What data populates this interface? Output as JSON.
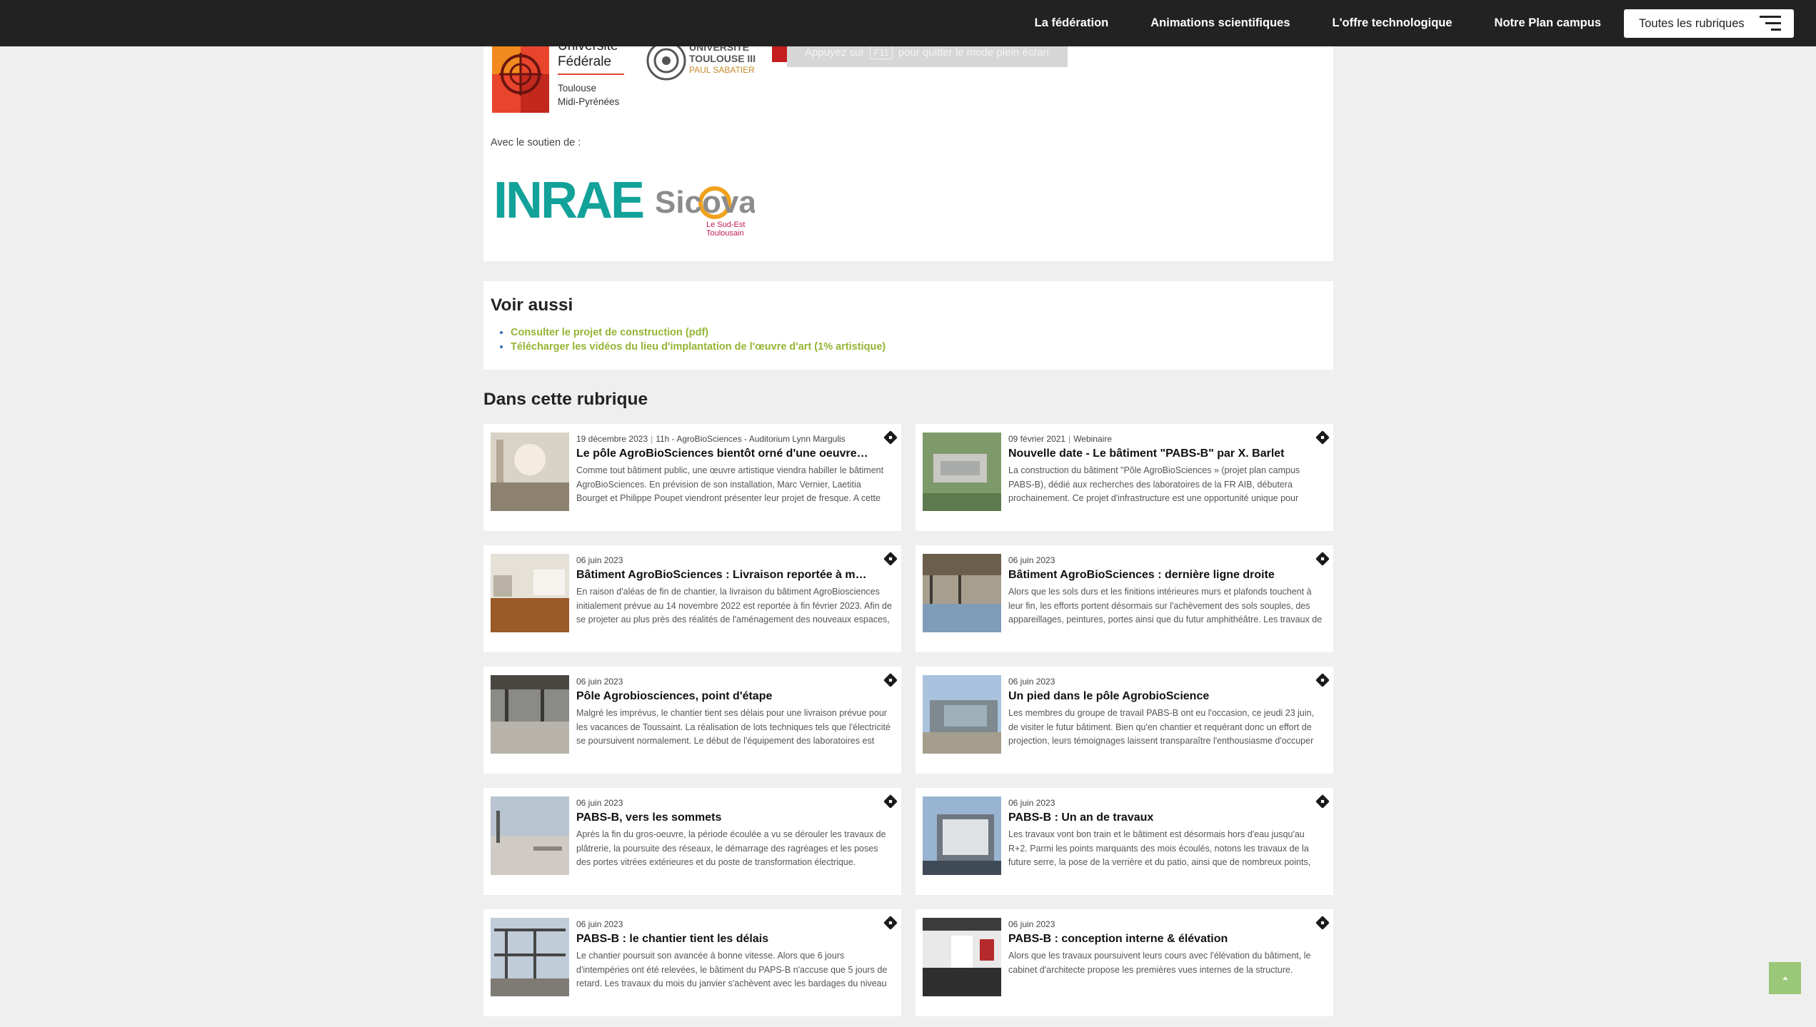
{
  "nav": {
    "items": [
      "La fédération",
      "Animations scientifiques",
      "L'offre technologique",
      "Notre Plan campus"
    ],
    "rubriques_label": "Toutes les rubriques"
  },
  "partners": {
    "ufmp_lines": [
      "Université",
      "Fédérale",
      "Toulouse",
      "Midi-Pyrénées"
    ],
    "ut3_lines": [
      "UNIVERSITÉ",
      "TOULOUSE III",
      "PAUL SABATIER"
    ],
    "esc_notice": {
      "before": "Appuyez sur",
      "key": "F11",
      "after": "pour quitter le mode plein écran"
    },
    "soutien_label": "Avec le soutien de :",
    "inrae": "INRAE",
    "sicoval": {
      "name": "Sicoval",
      "tagline1": "Le Sud-Est",
      "tagline2": "Toulousain"
    }
  },
  "voir_aussi": {
    "title": "Voir aussi",
    "links": [
      "Consulter le projet de construction (pdf)",
      "Télécharger les vidéos du lieu d'implantation de l'œuvre d'art (1% artistique)"
    ]
  },
  "rubrique": {
    "title": "Dans cette rubrique",
    "articles": [
      {
        "meta": [
          "19 décembre 2023",
          "11h - AgroBioSciences - Auditorium Lynn Margulis"
        ],
        "title": "Le pôle AgroBioSciences bientôt orné d'une oeuvre…",
        "text": "Comme tout bâtiment public, une œuvre artistique viendra habiller le bâtiment AgroBioSciences. En prévision de son installation, Marc Vernier, Laetitia Bourget et Philippe Poupet viendront présenter leur projet de fresque. A cette occasion, les…",
        "thumb": "atrium"
      },
      {
        "meta": [
          "09 février 2021",
          "Webinaire"
        ],
        "title": "Nouvelle date - Le bâtiment \"PABS-B\" par X. Barlet",
        "text": "La construction du bâtiment \"Pôle AgroBioSciences » (projet plan campus PABS-B), dédié aux recherches des laboratoires de la FR AIB, débutera prochainement. Ce projet d'infrastructure est une opportunité unique pour accroître les synergies entre équipes…",
        "thumb": "aerial"
      },
      {
        "meta": [
          "06 juin 2023"
        ],
        "title": "Bâtiment AgroBioSciences : Livraison reportée à mars…",
        "text": "En raison d'aléas de fin de chantier, la livraison du bâtiment AgroBiosciences initialement prévue au 14 novembre 2022 est reportée à fin février 2023. Afin de se projeter au plus près des réalités de l'aménagement des nouveaux espaces, le…",
        "thumb": "interior"
      },
      {
        "meta": [
          "06 juin 2023"
        ],
        "title": "Bâtiment AgroBioSciences : dernière ligne droite",
        "text": "Alors que les sols durs et les finitions intérieures murs et plafonds touchent à leur fin, les efforts portent désormais sur l'achèvement des sols souples, des appareillages, peintures, portes ainsi que du futur amphithéâtre. Les travaux de voirie, visibles de…",
        "thumb": "hall"
      },
      {
        "meta": [
          "06 juin 2023"
        ],
        "title": "Pôle Agrobiosciences, point d'étape",
        "text": "Malgré les imprévus, le chantier tient ses délais pour une livraison prévue pour les vacances de Toussaint. La réalisation de lots techniques tels que l'électricité se poursuivent normalement. Le début de l'équipement des laboratoires est prévu pour…",
        "thumb": "site"
      },
      {
        "meta": [
          "06 juin 2023"
        ],
        "title": "Un pied dans le pôle AgrobioScience",
        "text": "Les membres du groupe de travail PABS-B ont eu l'occasion, ce jeudi 23 juin, de visiter le futur bâtiment. Bien qu'en chantier et requérant donc un effort de projection, leurs témoignages laissent transparaître l'enthousiasme d'occuper un bâtiment moderne,…",
        "thumb": "facade"
      },
      {
        "meta": [
          "06 juin 2023"
        ],
        "title": "PABS-B, vers les sommets",
        "text": "Après la fin du gros-oeuvre, la période écoulée a vu se dérouler les travaux de plâtrerie, la poursuite des réseaux, le démarrage des ragréages et les poses des portes vitrées extérieures et du poste de transformation électrique. <em>Crédits photos : CRX Sud…",
        "thumb": "roof"
      },
      {
        "meta": [
          "06 juin 2023"
        ],
        "title": "PABS-B : Un an de travaux",
        "text": "Les travaux vont bon train et le bâtiment est désormais hors d'eau jusqu'au R+2. Parmi les points marquants des mois écoulés, notons les travaux de la future serre, la pose de la verrière et du patio, ainsi que de nombreux points, moins visibles mais tout aussi…",
        "thumb": "scaffold"
      },
      {
        "meta": [
          "06 juin 2023"
        ],
        "title": "PABS-B : le chantier tient les délais",
        "text": "Le chantier poursuit son avancée à bonne vitesse. Alors que 6 jours d'intempéries ont été relevées, le bâtiment du PAPS-B n'accuse que 5 jours de retard. Les travaux du mois du janvier s'achèvent avec les bardages du niveau supérieur, la livraison des huisserie…",
        "thumb": "frame"
      },
      {
        "meta": [
          "06 juin 2023"
        ],
        "title": "PABS-B : conception interne & élévation",
        "text": "Alors que les travaux poursuivent leurs cours avec l'élévation du bâtiment, le cabinet d'architecte propose les premières vues internes de la structure.",
        "thumb": "render"
      }
    ]
  },
  "colors": {
    "topbar": "#222222",
    "link_green": "#95b534",
    "bullet_blue": "#3a6db8",
    "inrae_teal": "#12a29a",
    "scrolltop": "#9bc878"
  }
}
